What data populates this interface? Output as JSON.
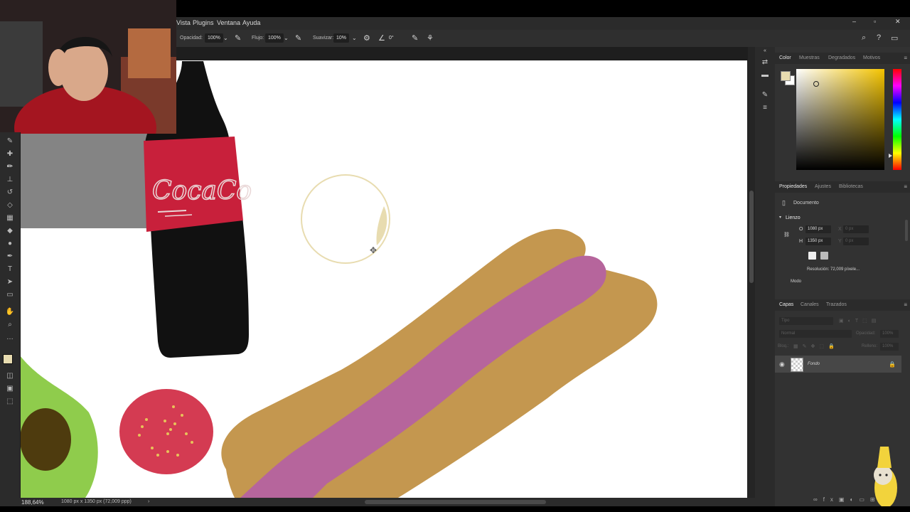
{
  "menubar": {
    "items": [
      "Vista",
      "Plugins",
      "Ventana",
      "Ayuda"
    ]
  },
  "options_bar": {
    "opacity_label": "Opacidad:",
    "opacity_value": "100%",
    "flow_label": "Flujo:",
    "flow_value": "100%",
    "smoothing_label": "Suavizar:",
    "smoothing_value": "10%",
    "angle_value": "0°"
  },
  "canvas": {
    "bottle_label": "CocaCo"
  },
  "status": {
    "zoom": "188,64%",
    "doc_info": "1080 px x 1350 px (72,009 ppp)"
  },
  "color_panel": {
    "tabs": [
      "Color",
      "Muestras",
      "Degradados",
      "Motivos"
    ],
    "foreground": "#e8dcb0",
    "background": "#ffffff"
  },
  "properties_panel": {
    "tabs": [
      "Propiedades",
      "Ajustes",
      "Bibliotecas"
    ],
    "doc_label": "Documento",
    "section": "Lienzo",
    "width_label": "O",
    "width_value": "1080 px",
    "height_label": "H",
    "height_value": "1350 px",
    "x_label": "X",
    "x_value": "0 px",
    "y_label": "Y",
    "y_value": "0 px",
    "resolution": "Resolución: 72,009 píxele...",
    "mode_label": "Modo"
  },
  "layers_panel": {
    "tabs": [
      "Capas",
      "Canales",
      "Trazados"
    ],
    "search_placeholder": "Tipo",
    "blend_mode": "Normal",
    "opacity_label": "Opacidad:",
    "opacity_value": "100%",
    "lock_label": "Bloq.:",
    "fill_label": "Relleno:",
    "fill_value": "100%",
    "layers": [
      {
        "name": "Fondo",
        "visible": true,
        "locked": true
      }
    ]
  },
  "colors": {
    "bun": "#c4974f",
    "sausage": "#b6659c",
    "can_red": "#c8203b",
    "bottle": "#111111",
    "avocado": "#8fcc4c",
    "avocado_pit": "#4e3b0e",
    "tomato": "#d43b52"
  }
}
